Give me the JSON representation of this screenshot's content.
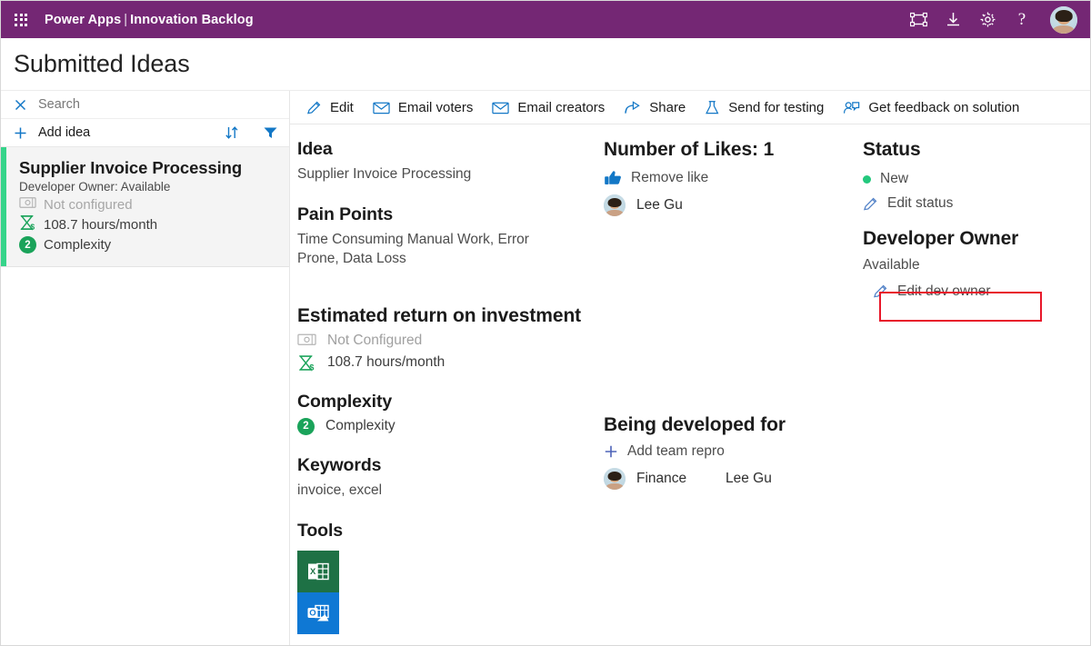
{
  "topbar": {
    "waffle_label": "app-launcher",
    "brand_primary": "Power Apps",
    "brand_separator": "|",
    "brand_secondary": "Innovation Backlog",
    "icons": [
      {
        "name": "fit-to-screen-icon",
        "title": "Fit to screen"
      },
      {
        "name": "download-icon",
        "title": "Download"
      },
      {
        "name": "settings-gear-icon",
        "title": "Settings"
      },
      {
        "name": "help-icon",
        "title": "Help",
        "glyph": "?"
      }
    ],
    "avatar_label": "user-avatar",
    "background_color": "#742774"
  },
  "page": {
    "title": "Submitted Ideas"
  },
  "left_pane": {
    "search": {
      "icon": "close-icon",
      "placeholder": "Search",
      "value": ""
    },
    "add_row": {
      "icon": "plus-icon",
      "label": "Add idea",
      "sort_icon": "sort-icon",
      "filter_icon": "filter-icon"
    },
    "ideas": [
      {
        "title": "Supplier Invoice Processing",
        "subtitle": "Developer Owner: Available",
        "roi_money_icon": "money-bill-icon",
        "roi_money_value": "Not configured",
        "roi_time_icon": "hourglass-dollar-icon",
        "roi_time_value": "108.7 hours/month",
        "complexity_badge": "2",
        "complexity_label": "Complexity",
        "accent_color": "#36d48a"
      }
    ]
  },
  "command_bar": [
    {
      "icon": "pencil-icon",
      "label": "Edit"
    },
    {
      "icon": "envelope-icon",
      "label": "Email voters"
    },
    {
      "icon": "envelope-icon",
      "label": "Email creators"
    },
    {
      "icon": "share-icon",
      "label": "Share"
    },
    {
      "icon": "flask-icon",
      "label": "Send for testing"
    },
    {
      "icon": "feedback-person-icon",
      "label": "Get feedback on solution"
    }
  ],
  "detail": {
    "idea": {
      "heading": "Idea",
      "value": "Supplier Invoice Processing"
    },
    "pain_points": {
      "heading": "Pain Points",
      "value": "Time Consuming Manual Work, Error Prone, Data Loss"
    },
    "roi": {
      "heading": "Estimated return on investment",
      "money_icon": "money-bill-icon",
      "money_value": "Not Configured",
      "time_icon": "hourglass-dollar-icon",
      "time_value": "108.7 hours/month"
    },
    "complexity": {
      "heading": "Complexity",
      "badge": "2",
      "label": "Complexity"
    },
    "keywords": {
      "heading": "Keywords",
      "value": "invoice, excel"
    },
    "tools": {
      "heading": "Tools",
      "items": [
        {
          "name": "excel-tool-icon",
          "label": "Excel",
          "color": "#1e7145"
        },
        {
          "name": "outlook-tool-icon",
          "label": "Outlook",
          "color": "#0f78d4"
        }
      ]
    },
    "likes": {
      "heading": "Number of Likes: 1",
      "action_icon": "thumbs-up-icon",
      "action_label": "Remove like",
      "voters": [
        {
          "avatar": "voter-avatar",
          "name": "Lee Gu"
        }
      ]
    },
    "developed_for": {
      "heading": "Being developed for",
      "add_icon": "plus-icon",
      "add_label": "Add team repro",
      "teams": [
        {
          "avatar": "team-avatar",
          "team": "Finance",
          "person": "Lee Gu"
        }
      ]
    },
    "status": {
      "heading": "Status",
      "dot_color": "#23c87d",
      "value": "New",
      "edit_icon": "pencil-icon",
      "edit_label": "Edit status"
    },
    "developer_owner": {
      "heading": "Developer Owner",
      "value": "Available",
      "edit_icon": "pencil-icon",
      "edit_label": "Edit dev owner",
      "highlight_color": "#e8172a"
    }
  }
}
